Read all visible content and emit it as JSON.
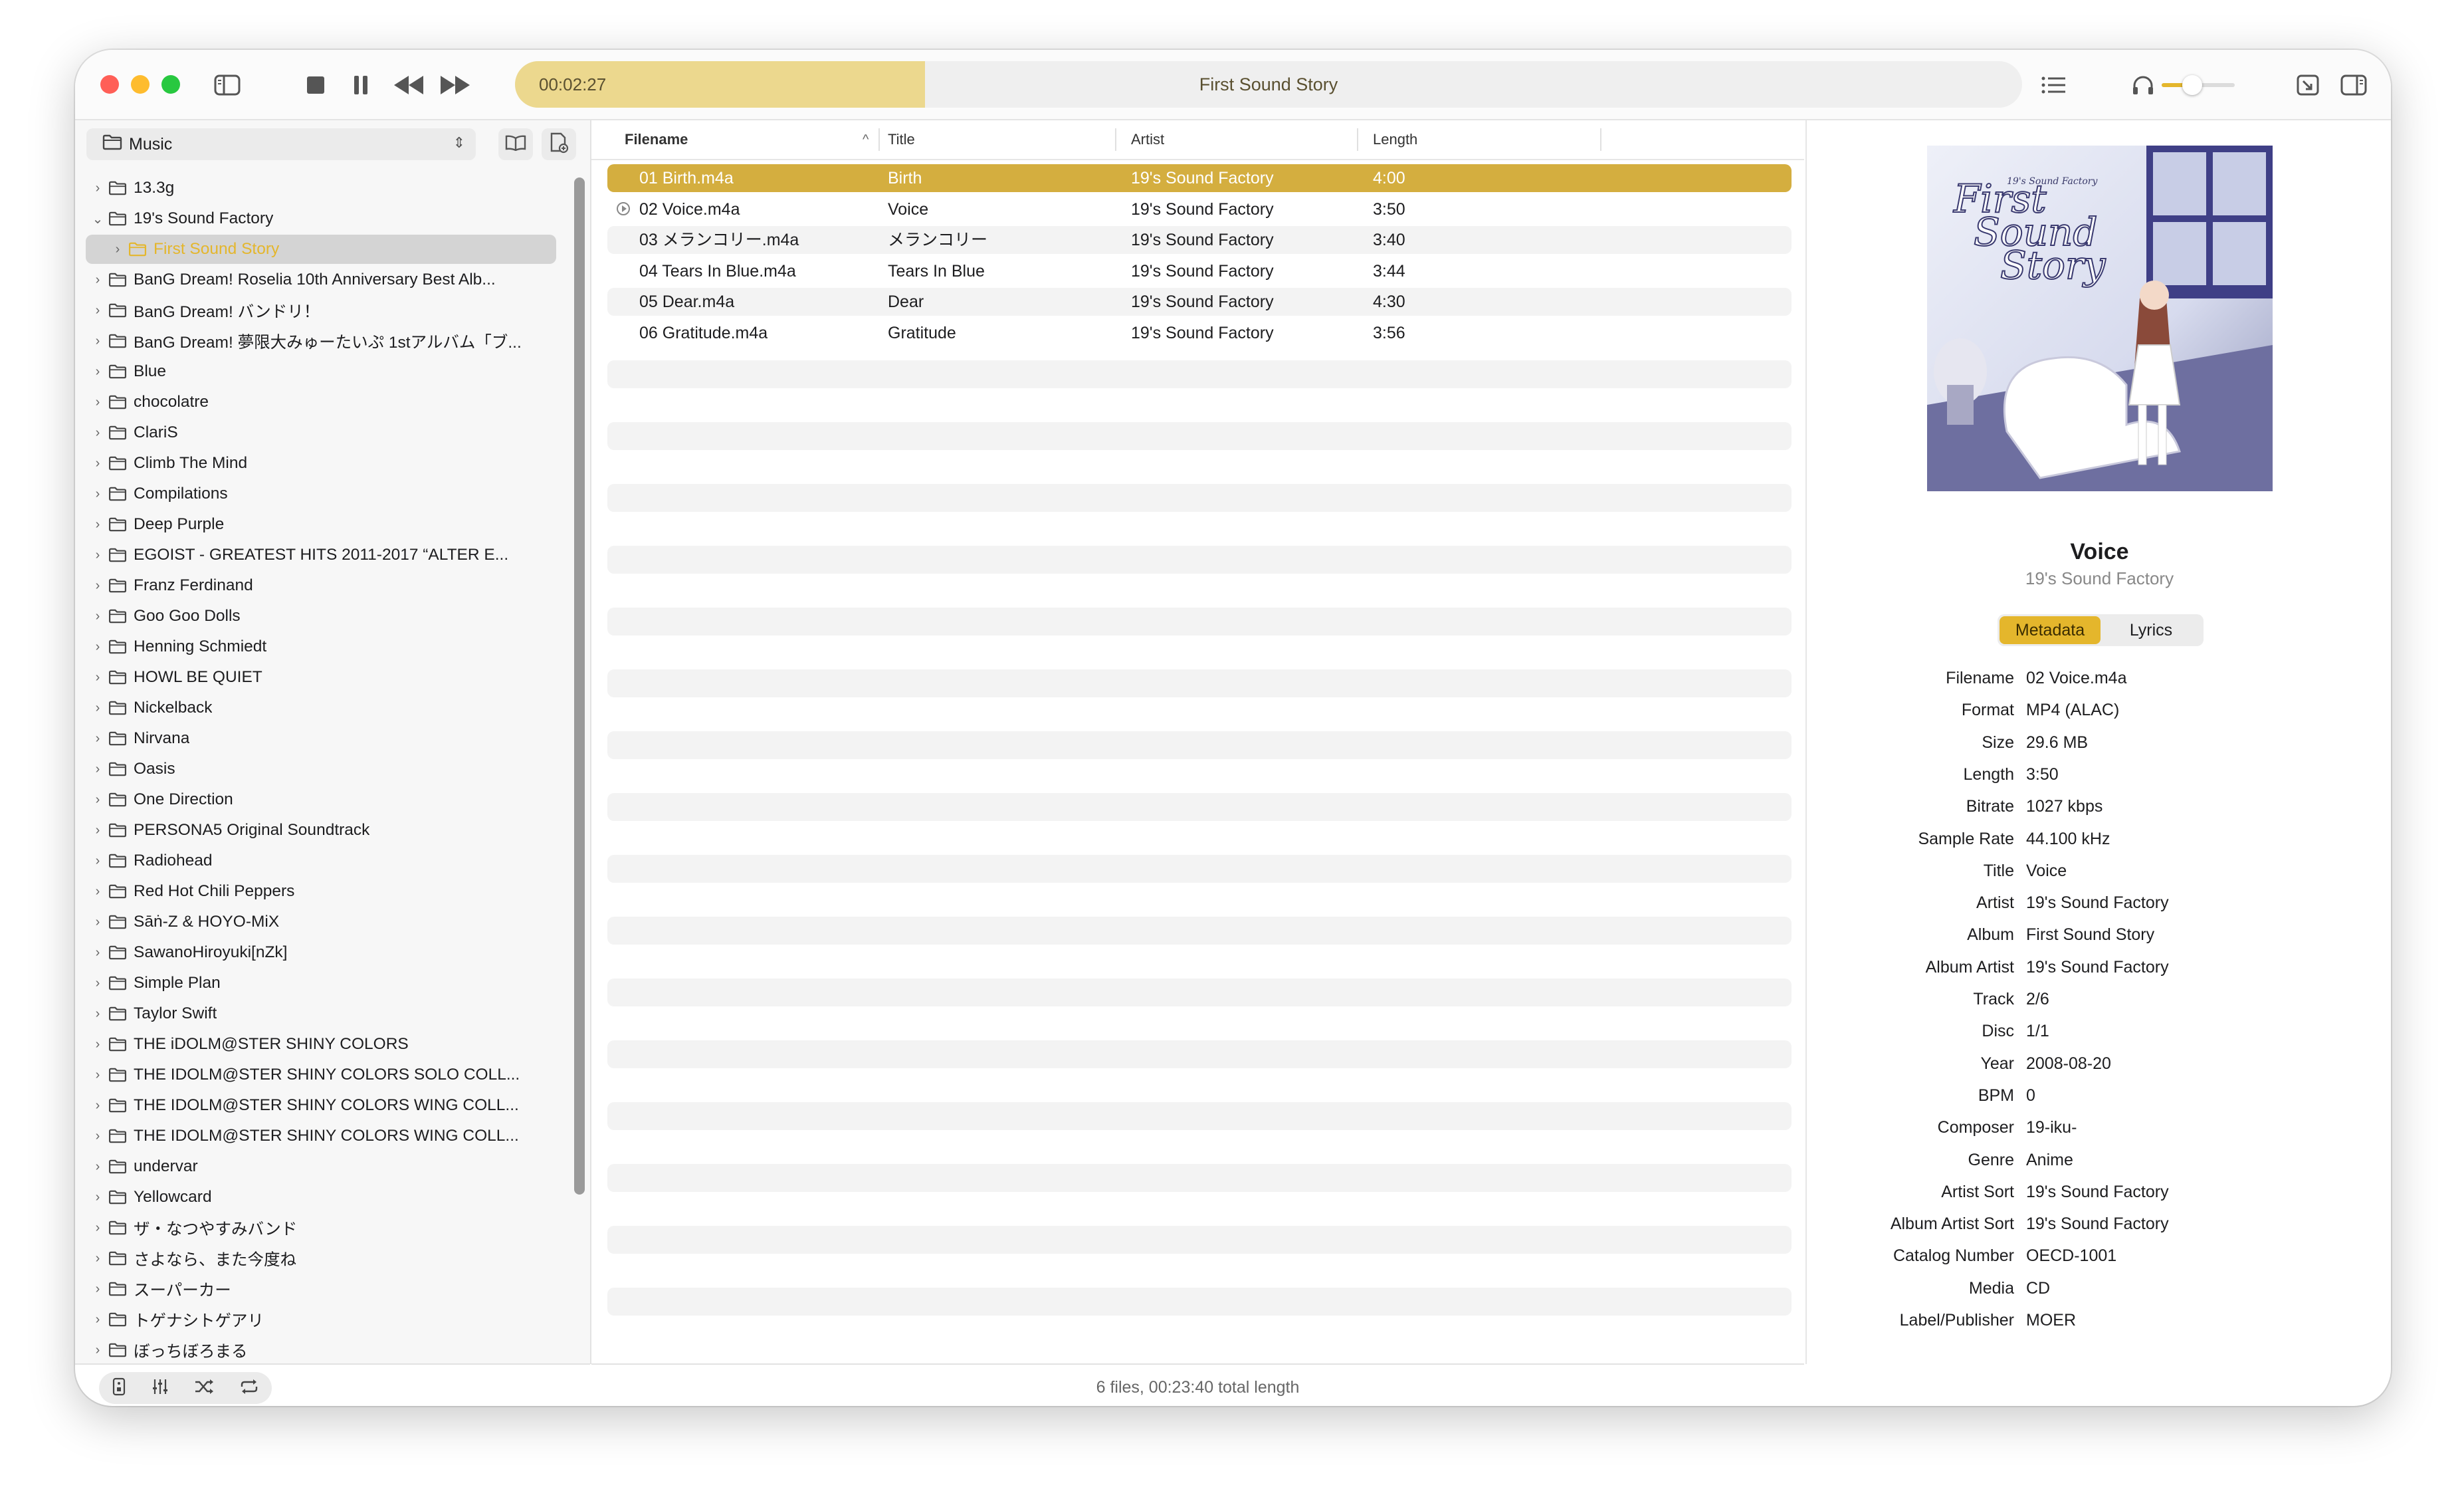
{
  "player": {
    "elapsed": "00:02:27",
    "now_playing": "First Sound Story",
    "progress_fraction": 0.272,
    "volume_fraction": 0.42
  },
  "sidebar": {
    "source": "Music",
    "items": [
      {
        "label": "13.3g",
        "expanded": false,
        "depth": 0
      },
      {
        "label": "19's Sound Factory",
        "expanded": true,
        "depth": 0
      },
      {
        "label": "First Sound Story",
        "expanded": false,
        "depth": 1,
        "selected": true
      },
      {
        "label": "BanG Dream! Roselia 10th Anniversary Best Alb...",
        "expanded": false,
        "depth": 0
      },
      {
        "label": "BanG Dream! バンドリ！",
        "expanded": false,
        "depth": 0
      },
      {
        "label": "BanG Dream! 夢限大みゅーたいぷ 1stアルバム「ブ...",
        "expanded": false,
        "depth": 0
      },
      {
        "label": "Blue",
        "expanded": false,
        "depth": 0
      },
      {
        "label": "chocolatre",
        "expanded": false,
        "depth": 0
      },
      {
        "label": "ClariS",
        "expanded": false,
        "depth": 0
      },
      {
        "label": "Climb The Mind",
        "expanded": false,
        "depth": 0
      },
      {
        "label": "Compilations",
        "expanded": false,
        "depth": 0
      },
      {
        "label": "Deep Purple",
        "expanded": false,
        "depth": 0
      },
      {
        "label": "EGOIST - GREATEST HITS 2011-2017 “ALTER E...",
        "expanded": false,
        "depth": 0
      },
      {
        "label": "Franz Ferdinand",
        "expanded": false,
        "depth": 0
      },
      {
        "label": "Goo Goo Dolls",
        "expanded": false,
        "depth": 0
      },
      {
        "label": "Henning Schmiedt",
        "expanded": false,
        "depth": 0
      },
      {
        "label": "HOWL BE QUIET",
        "expanded": false,
        "depth": 0
      },
      {
        "label": "Nickelback",
        "expanded": false,
        "depth": 0
      },
      {
        "label": "Nirvana",
        "expanded": false,
        "depth": 0
      },
      {
        "label": "Oasis",
        "expanded": false,
        "depth": 0
      },
      {
        "label": "One Direction",
        "expanded": false,
        "depth": 0
      },
      {
        "label": "PERSONA5 Original Soundtrack",
        "expanded": false,
        "depth": 0
      },
      {
        "label": "Radiohead",
        "expanded": false,
        "depth": 0
      },
      {
        "label": "Red Hot Chili Peppers",
        "expanded": false,
        "depth": 0
      },
      {
        "label": "Sāṅ-Z & HOYO-MiX",
        "expanded": false,
        "depth": 0
      },
      {
        "label": "SawanoHiroyuki[nZk]",
        "expanded": false,
        "depth": 0
      },
      {
        "label": "Simple Plan",
        "expanded": false,
        "depth": 0
      },
      {
        "label": "Taylor Swift",
        "expanded": false,
        "depth": 0
      },
      {
        "label": "THE iDOLM@STER SHINY COLORS",
        "expanded": false,
        "depth": 0
      },
      {
        "label": "THE IDOLM@STER SHINY COLORS SOLO COLL...",
        "expanded": false,
        "depth": 0
      },
      {
        "label": "THE IDOLM@STER SHINY COLORS WING COLL...",
        "expanded": false,
        "depth": 0
      },
      {
        "label": "THE IDOLM@STER SHINY COLORS WING COLL...",
        "expanded": false,
        "depth": 0
      },
      {
        "label": "undervar",
        "expanded": false,
        "depth": 0
      },
      {
        "label": "Yellowcard",
        "expanded": false,
        "depth": 0
      },
      {
        "label": "ザ・なつやすみバンド",
        "expanded": false,
        "depth": 0
      },
      {
        "label": "さよなら、また今度ね",
        "expanded": false,
        "depth": 0
      },
      {
        "label": "スーパーカー",
        "expanded": false,
        "depth": 0
      },
      {
        "label": "トゲナシトゲアリ",
        "expanded": false,
        "depth": 0
      },
      {
        "label": "ぼっちぼろまる",
        "expanded": false,
        "depth": 0
      }
    ]
  },
  "table": {
    "columns": [
      "Filename",
      "Title",
      "Artist",
      "Length"
    ],
    "rows": [
      {
        "filename": "01 Birth.m4a",
        "title": "Birth",
        "artist": "19's Sound Factory",
        "length": "4:00",
        "selected": true,
        "playing": false
      },
      {
        "filename": "02 Voice.m4a",
        "title": "Voice",
        "artist": "19's Sound Factory",
        "length": "3:50",
        "selected": false,
        "playing": true
      },
      {
        "filename": "03 メランコリー.m4a",
        "title": "メランコリー",
        "artist": "19's Sound Factory",
        "length": "3:40",
        "selected": false,
        "playing": false
      },
      {
        "filename": "04 Tears In Blue.m4a",
        "title": "Tears In Blue",
        "artist": "19's Sound Factory",
        "length": "3:44",
        "selected": false,
        "playing": false
      },
      {
        "filename": "05 Dear.m4a",
        "title": "Dear",
        "artist": "19's Sound Factory",
        "length": "4:30",
        "selected": false,
        "playing": false
      },
      {
        "filename": "06 Gratitude.m4a",
        "title": "Gratitude",
        "artist": "19's Sound Factory",
        "length": "3:56",
        "selected": false,
        "playing": false
      }
    ],
    "status": "6 files, 00:23:40 total length"
  },
  "inspector": {
    "title": "Voice",
    "artist": "19's Sound Factory",
    "tabs": [
      "Metadata",
      "Lyrics"
    ],
    "active_tab": "Metadata",
    "fields": [
      {
        "key": "Filename",
        "value": "02 Voice.m4a"
      },
      {
        "key": "Format",
        "value": "MP4 (ALAC)"
      },
      {
        "key": "Size",
        "value": "29.6 MB"
      },
      {
        "key": "Length",
        "value": "3:50"
      },
      {
        "key": "Bitrate",
        "value": "1027 kbps"
      },
      {
        "key": "Sample Rate",
        "value": "44.100 kHz"
      },
      {
        "key": "Title",
        "value": "Voice"
      },
      {
        "key": "Artist",
        "value": "19's Sound Factory"
      },
      {
        "key": "Album",
        "value": "First Sound Story"
      },
      {
        "key": "Album Artist",
        "value": "19's Sound Factory"
      },
      {
        "key": "Track",
        "value": "2/6"
      },
      {
        "key": "Disc",
        "value": "1/1"
      },
      {
        "key": "Year",
        "value": "2008-08-20"
      },
      {
        "key": "BPM",
        "value": "0"
      },
      {
        "key": "Composer",
        "value": "19-iku-"
      },
      {
        "key": "Genre",
        "value": "Anime"
      },
      {
        "key": "Artist Sort",
        "value": "19's Sound Factory"
      },
      {
        "key": "Album Artist Sort",
        "value": "19's Sound Factory"
      },
      {
        "key": "Catalog Number",
        "value": "OECD-1001"
      },
      {
        "key": "Media",
        "value": "CD"
      },
      {
        "key": "Label/Publisher",
        "value": "MOER"
      }
    ],
    "cover_text": {
      "publisher": "19's Sound Factory",
      "line1": "First",
      "line2": "Sound",
      "line3": "Story"
    }
  },
  "colors": {
    "accent": "#d4ae3f",
    "segment_active": "#e4b62c",
    "progress_fill": "#ecd88e",
    "traffic_red": "#ff5f57",
    "traffic_yellow": "#febc2e",
    "traffic_green": "#28c840"
  }
}
